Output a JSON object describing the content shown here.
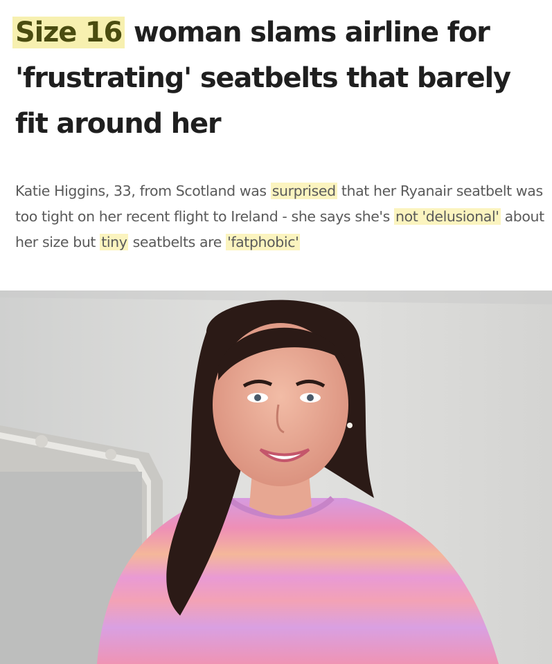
{
  "article": {
    "headline": {
      "highlight": "Size 16",
      "rest": " woman slams airline for 'frustrating' seatbelts that barely fit around her"
    },
    "standfirst": {
      "part1": "Katie Higgins, 33, from Scotland was ",
      "hl1": "surprised",
      "part2": " that her Ryanair seatbelt was too tight on her recent flight to Ireland - she says she's ",
      "hl2": "not 'delusional'",
      "part3": " about her size but ",
      "hl3": "tiny",
      "part4": " seatbelts are ",
      "hl4": "'fatphobic'"
    },
    "colors": {
      "headline_text": "#1f1f1f",
      "headline_highlight_bg": "#f7f0b0",
      "standfirst_text": "#5a5a5a",
      "standfirst_highlight_bg": "#fbf4bf",
      "sweater_pink": "#ee8fb6",
      "sweater_lilac": "#d69be0",
      "sweater_peach": "#f4b79a",
      "hair": "#2b1a16"
    }
  }
}
